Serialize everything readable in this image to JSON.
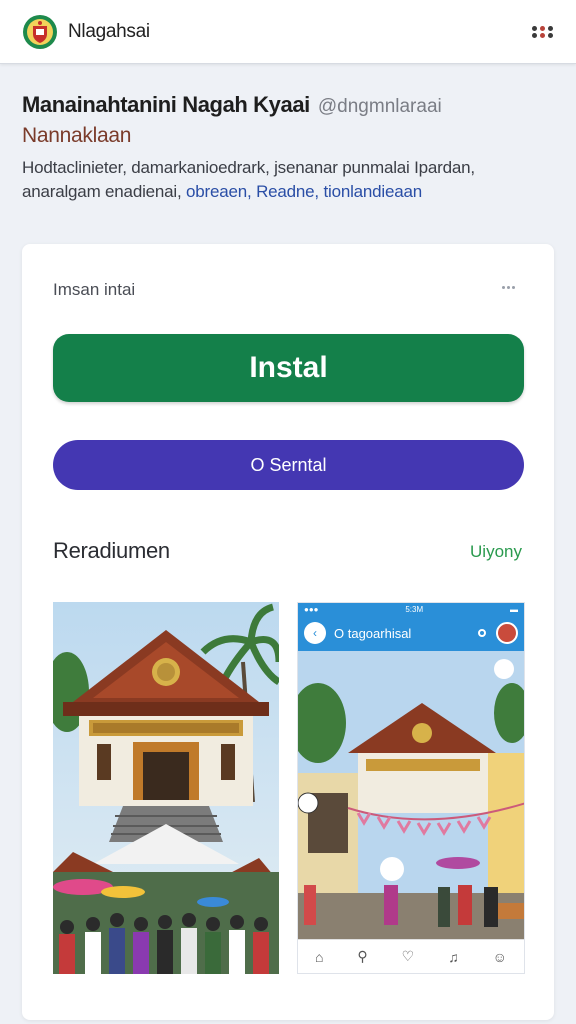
{
  "topbar": {
    "app_name": "Nlagahsai",
    "logo_icon": "crest-logo-icon",
    "menu_icon": "app-grid-icon"
  },
  "header": {
    "title": "Manainahtanini Nagah Kyaai",
    "handle": "@dngmnlaraai",
    "subtitle": "Nannaklaan",
    "description_line1": "Hodtaclinieter, damarkanioedrark, jsenanar punmalai Ipardan,",
    "description_line2_plain": "anaralgam enadienai, ",
    "description_line2_link": "obreaen, Readne, tionlandieaan"
  },
  "card": {
    "label": "Imsan intai",
    "install_label": "Instal",
    "secondary_label": "O Serntal",
    "section_title": "Reradiumen",
    "section_link": "Uiyony"
  },
  "screenshots": {
    "phone_title": "O tagoarhisal",
    "phone_time": "5:3M"
  },
  "colors": {
    "install_green": "#14804a",
    "secondary_purple": "#4437b2",
    "link_green": "#2a9a4e",
    "phone_blue": "#2a8fd8"
  }
}
